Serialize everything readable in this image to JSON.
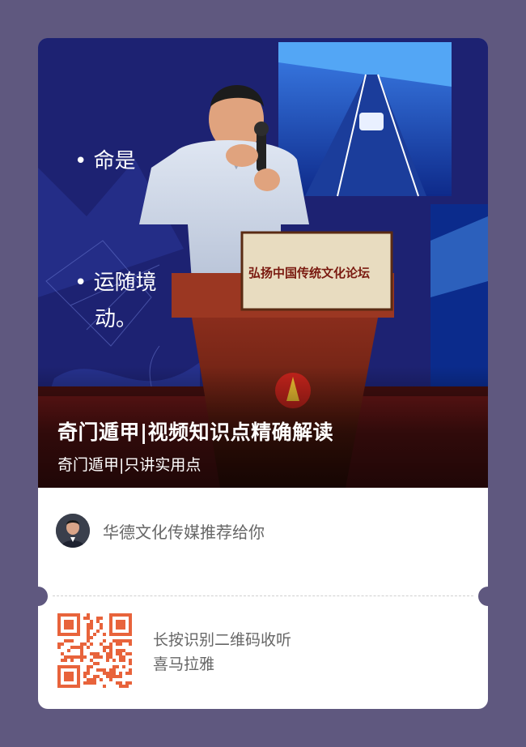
{
  "cover": {
    "title": "奇门遁甲|视频知识点精确解读",
    "subtitle": "奇门遁甲|只讲实用点",
    "screen_text_1": "• 命是",
    "screen_text_2": "• 运随境",
    "screen_text_3": "动。",
    "podium_banner": "弘扬中国传统文化论坛"
  },
  "recommender": {
    "text": "华德文化传媒推荐给你"
  },
  "qr": {
    "line1": "长按识别二维码收听",
    "line2": "喜马拉雅"
  },
  "colors": {
    "background": "#5f587f",
    "card": "#ffffff",
    "qr": "#e8633b",
    "text_muted": "#666666"
  }
}
